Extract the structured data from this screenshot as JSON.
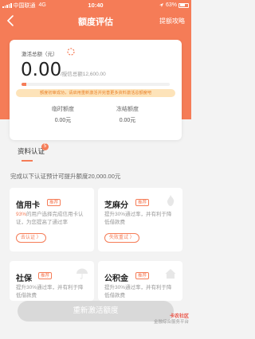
{
  "status_bar": {
    "carrier": "中国联通",
    "network": "4G",
    "time": "10:40",
    "battery": "63%"
  },
  "nav": {
    "title": "额度评估",
    "strategy": "提额攻略"
  },
  "credit_card": {
    "activation_label": "激活总额（元）",
    "amount": "0.00",
    "credit_total": "/授信总额12,600.00",
    "progress_fraction": 0.03,
    "notice": "额度初审成功，请启用重新激活并完善更多资料激活总额度吧",
    "temp_label": "临时额度",
    "temp_value": "0.00元",
    "frozen_label": "冻结额度",
    "frozen_value": "0.00元"
  },
  "section": {
    "title": "资料认证",
    "badge": "5",
    "subtitle": "完成以下认证预计可提升额度20,000.00元"
  },
  "items": [
    {
      "name": "信用卡",
      "tag": "推荐",
      "desc_hl": "93%",
      "desc": "的用户选择完成信用卡认证，为您提高了通过率",
      "button": "去认证 〉"
    },
    {
      "name": "芝麻分",
      "tag": "推荐",
      "desc_hl": "",
      "desc": "提升30%通过率，并有利于降低借款费",
      "button": "失败重试 〉"
    },
    {
      "name": "社保",
      "tag": "推荐",
      "desc_hl": "",
      "desc": "提升30%通过率，并有利于降低借款费",
      "button": ""
    },
    {
      "name": "公积金",
      "tag": "推荐",
      "desc_hl": "",
      "desc": "提升30%通过率，并有利于降低借款费",
      "button": ""
    }
  ],
  "cta_label": "重新激活额度",
  "watermark": {
    "brand": "卡农社区",
    "sub": "金融综合服务平台"
  },
  "colors": {
    "accent": "#f57c57",
    "notice_bg": "#fde3b9",
    "disabled_button": "#d9d9d9"
  }
}
